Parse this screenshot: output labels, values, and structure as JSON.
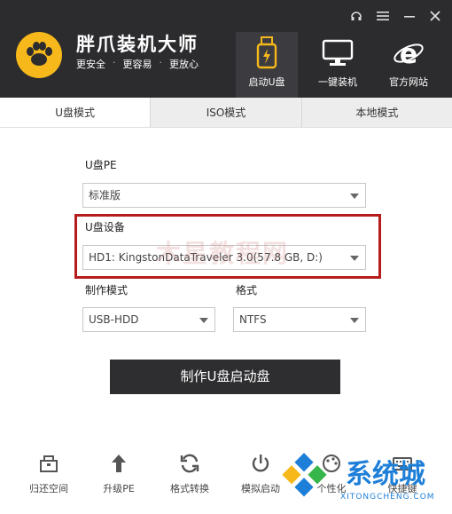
{
  "header": {
    "title": "胖爪装机大师",
    "slogans": [
      "更安全",
      "更容易",
      "更放心"
    ],
    "separator": "·",
    "nav": [
      {
        "label": "启动U盘",
        "icon": "usb-drive-icon",
        "active": true
      },
      {
        "label": "一键装机",
        "icon": "monitor-icon",
        "active": false
      },
      {
        "label": "官方网站",
        "icon": "ie-browser-icon",
        "active": false
      }
    ]
  },
  "tabs": [
    {
      "label": "U盘模式",
      "active": true
    },
    {
      "label": "ISO模式",
      "active": false
    },
    {
      "label": "本地模式",
      "active": false
    }
  ],
  "form": {
    "pe_label": "U盘PE",
    "pe_value": "标准版",
    "device_label": "U盘设备",
    "device_value": "HD1: KingstonDataTraveler 3.0(57.8 GB, D:)",
    "mode_label": "制作模式",
    "mode_value": "USB-HDD",
    "format_label": "格式",
    "format_value": "NTFS"
  },
  "make_button": "制作U盘启动盘",
  "toolbar": [
    {
      "label": "归还空间",
      "icon": "restore-space-icon"
    },
    {
      "label": "升级PE",
      "icon": "upgrade-arrow-icon"
    },
    {
      "label": "格式转换",
      "icon": "convert-icon"
    },
    {
      "label": "模拟启动",
      "icon": "power-icon"
    },
    {
      "label": "个性化",
      "icon": "personalize-icon"
    },
    {
      "label": "快捷键",
      "icon": "keyboard-icon"
    }
  ],
  "watermark": {
    "center": "木星教程网",
    "brand": "系统城",
    "brand_url": "XITONGCHENG.COM"
  },
  "colors": {
    "header_bg": "#2c2c2e",
    "accent_yellow": "#f6b81a",
    "highlight_red": "#b71c1c",
    "button_bg": "#2e2e30",
    "brand_blue": "#1e7fd8"
  }
}
